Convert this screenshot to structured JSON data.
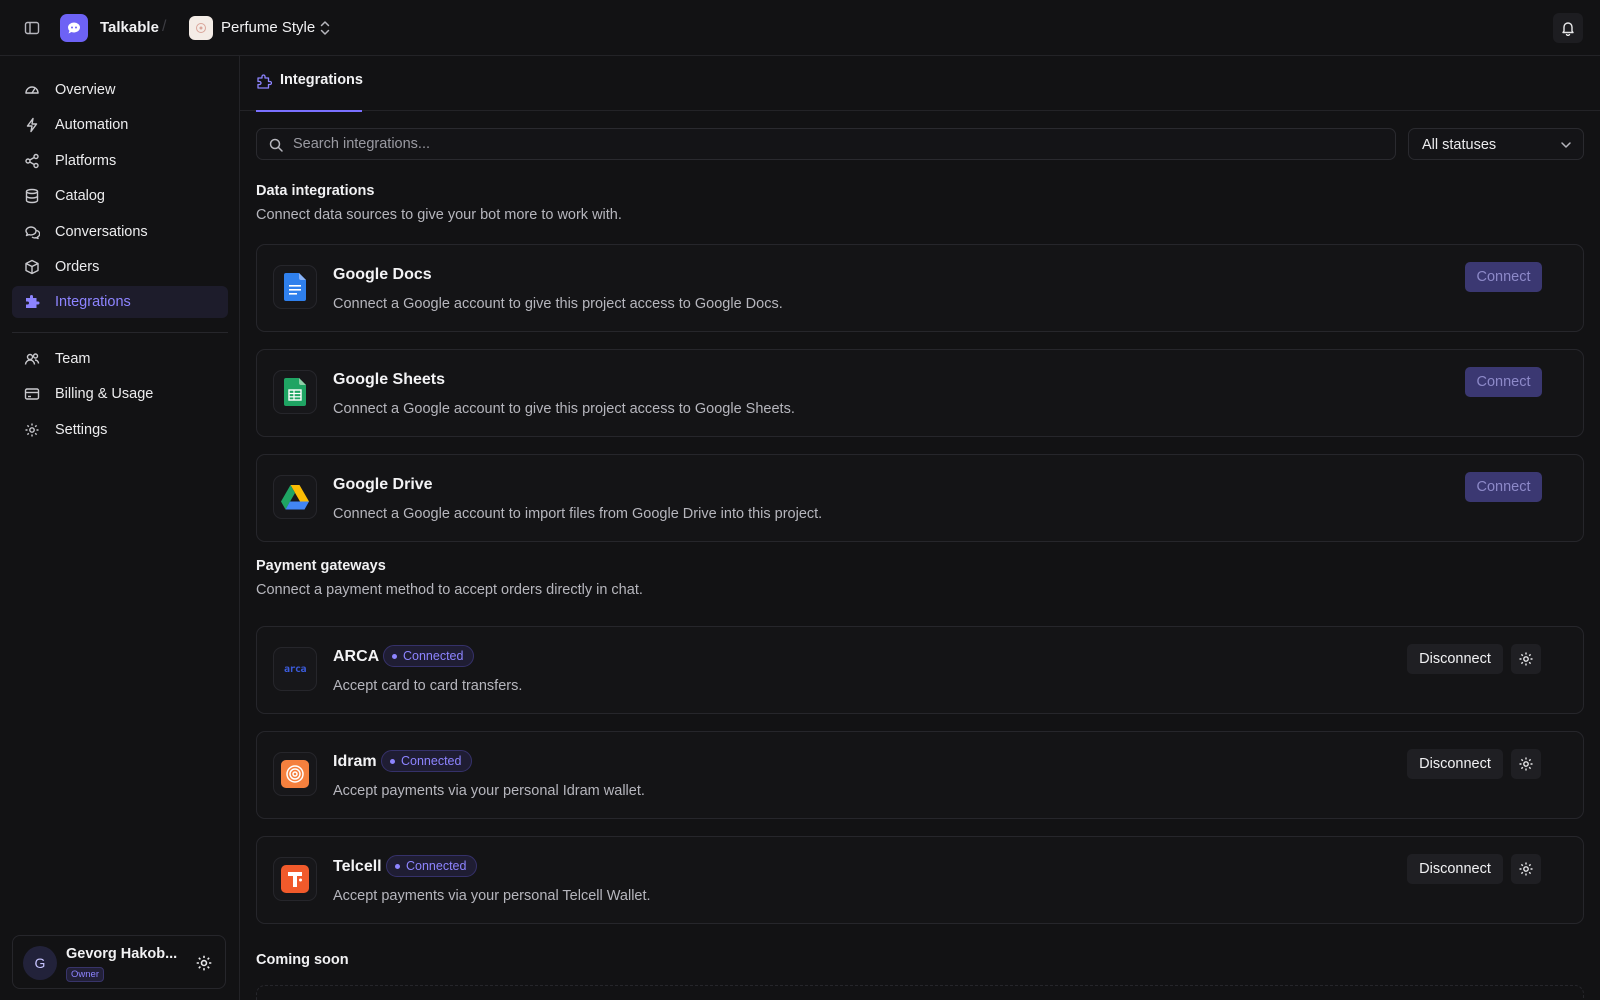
{
  "topbar": {
    "brand": "Talkable",
    "project": "Perfume Style"
  },
  "sidebar": {
    "items": [
      {
        "label": "Overview",
        "icon": "gauge-icon"
      },
      {
        "label": "Automation",
        "icon": "bolt-icon"
      },
      {
        "label": "Platforms",
        "icon": "share-icon"
      },
      {
        "label": "Catalog",
        "icon": "database-icon"
      },
      {
        "label": "Conversations",
        "icon": "chat-icon"
      },
      {
        "label": "Orders",
        "icon": "box-icon"
      },
      {
        "label": "Integrations",
        "icon": "puzzle-icon",
        "active": true
      },
      {
        "label": "Team",
        "icon": "users-icon"
      },
      {
        "label": "Billing & Usage",
        "icon": "card-icon"
      },
      {
        "label": "Settings",
        "icon": "gear-icon"
      }
    ],
    "user": {
      "initial": "G",
      "name": "Gevorg Hakob...",
      "role": "Owner"
    }
  },
  "main": {
    "tab": "Integrations",
    "search_placeholder": "Search integrations...",
    "status_filter": "All statuses",
    "data_section": {
      "title": "Data integrations",
      "description": "Connect data sources to give your bot more to work with.",
      "cards": [
        {
          "name": "Google Docs",
          "description": "Connect a Google account to give this project access to Google Docs.",
          "action": "Connect"
        },
        {
          "name": "Google Sheets",
          "description": "Connect a Google account to give this project access to Google Sheets.",
          "action": "Connect"
        },
        {
          "name": "Google Drive",
          "description": "Connect a Google account to import files from Google Drive into this project.",
          "action": "Connect"
        }
      ]
    },
    "payment_section": {
      "title": "Payment gateways",
      "description": "Connect a payment method to accept orders directly in chat.",
      "cards": [
        {
          "name": "ARCA",
          "logo_text": "arca",
          "status": "Connected",
          "description": "Accept card to card transfers.",
          "action": "Disconnect"
        },
        {
          "name": "Idram",
          "status": "Connected",
          "description": "Accept payments via your personal Idram wallet.",
          "action": "Disconnect"
        },
        {
          "name": "Telcell",
          "status": "Connected",
          "description": "Accept payments via your personal Telcell Wallet.",
          "action": "Disconnect"
        }
      ]
    },
    "coming_soon": {
      "title": "Coming soon"
    }
  },
  "colors": {
    "accent": "#7a70ff",
    "background": "#121214",
    "card": "#141416",
    "connect_button": "#3b3872"
  }
}
